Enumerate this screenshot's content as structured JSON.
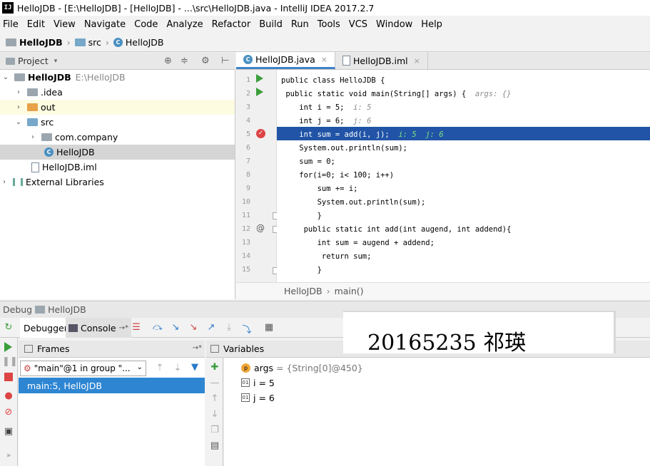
{
  "titlebar": {
    "text": "HelloJDB - [E:\\HelloJDB] - [HelloJDB] - ...\\src\\HelloJDB.java - IntelliJ IDEA 2017.2.7",
    "logo": "IJ"
  },
  "menu": [
    "File",
    "Edit",
    "View",
    "Navigate",
    "Code",
    "Analyze",
    "Refactor",
    "Build",
    "Run",
    "Tools",
    "VCS",
    "Window",
    "Help"
  ],
  "breadcrumb": [
    "HelloJDB",
    "src",
    "HelloJDB"
  ],
  "project": {
    "header": "Project",
    "tree": [
      {
        "label": "HelloJDB",
        "extra": "E:\\HelloJDB"
      },
      {
        "label": ".idea"
      },
      {
        "label": "out"
      },
      {
        "label": "src"
      },
      {
        "label": "com.company"
      },
      {
        "label": "HelloJDB"
      },
      {
        "label": "HelloJDB.iml"
      },
      {
        "label": "External Libraries"
      }
    ]
  },
  "editor": {
    "tabs": [
      "HelloJDB.java",
      "HelloJDB.iml"
    ],
    "line_numbers": [
      "1",
      "2",
      "3",
      "4",
      "5",
      "6",
      "7",
      "8",
      "9",
      "10",
      "11",
      "12",
      "13",
      "14",
      "15"
    ],
    "lines": [
      {
        "code": "public class HelloJDB {"
      },
      {
        "code": " public static void main(String[] args) {",
        "hint": "args: {}"
      },
      {
        "code": "    int i = 5;",
        "hint": "i: 5"
      },
      {
        "code": "    int j = 6;",
        "hint": "j: 6"
      },
      {
        "code": "    int sum = add(i, j);",
        "hint": "i: 5  j: 6"
      },
      {
        "code": "    System.out.println(sum);"
      },
      {
        "code": "    sum = 0;"
      },
      {
        "code": "    for(i=0; i< 100; i++)"
      },
      {
        "code": "        sum += i;"
      },
      {
        "code": "        System.out.println(sum);"
      },
      {
        "code": "        }"
      },
      {
        "code": "     public static int add(int augend, int addend){"
      },
      {
        "code": "        int sum = augend + addend;"
      },
      {
        "code": "         return sum;"
      },
      {
        "code": "        }"
      }
    ],
    "crumb": [
      "HelloJDB",
      "main()"
    ]
  },
  "debug": {
    "title": "Debug",
    "config": "HelloJDB",
    "tabs": [
      "Debugger",
      "Console"
    ],
    "frames_label": "Frames",
    "thread": "\"main\"@1 in group \"...",
    "frame": "main:5, HelloJDB",
    "variables_label": "Variables",
    "variables": [
      {
        "icon": "p",
        "name": "args",
        "value": "= {String[0]@450}"
      },
      {
        "icon": "01",
        "name": "i",
        "value": "= 5"
      },
      {
        "icon": "01",
        "name": "j",
        "value": "= 6"
      }
    ]
  },
  "overlay_text": "20165235 祁瑛"
}
